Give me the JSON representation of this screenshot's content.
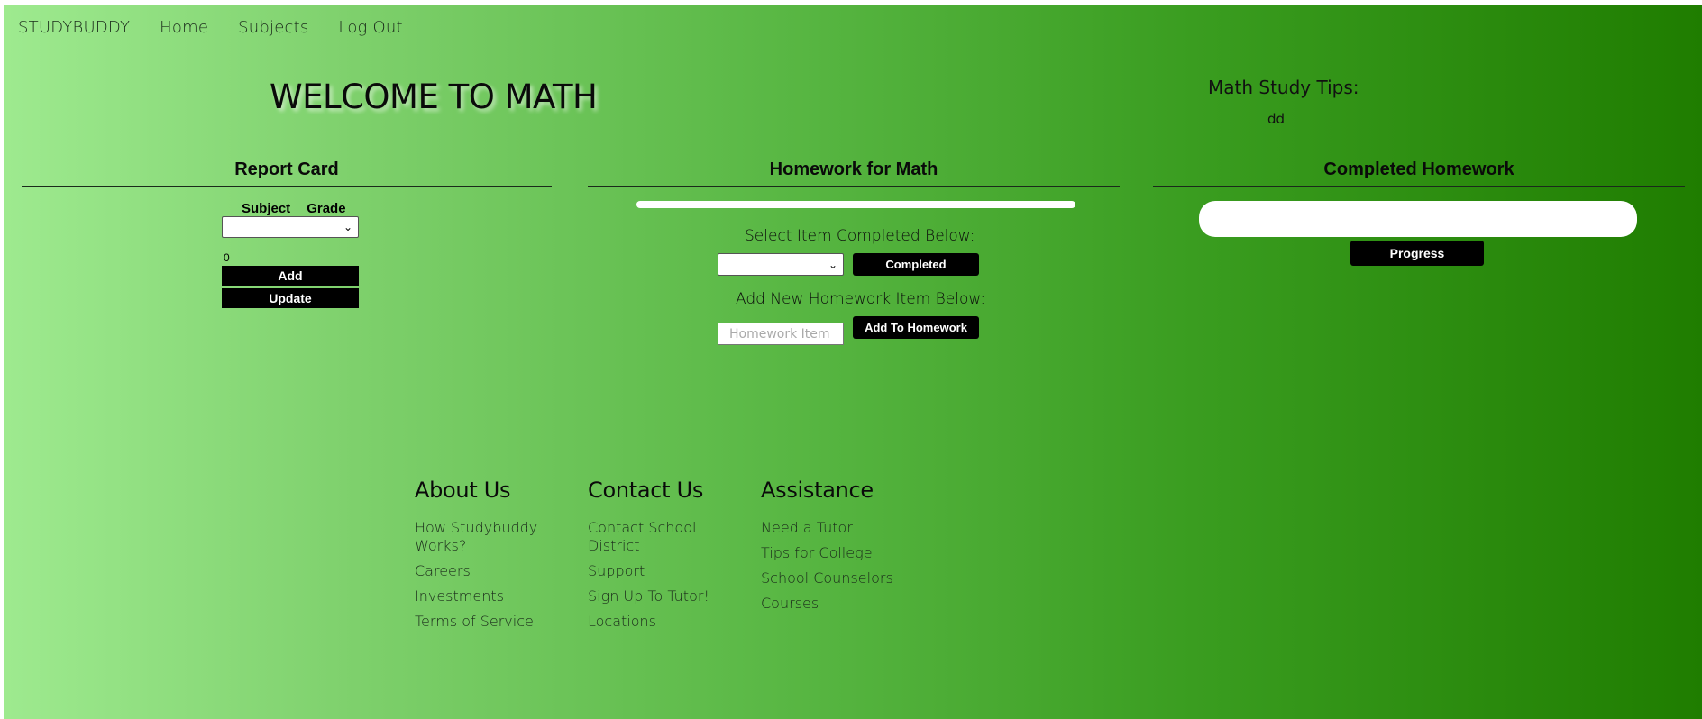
{
  "nav": {
    "brand": "STUDYBUDDY",
    "items": [
      "Home",
      "Subjects",
      "Log Out"
    ]
  },
  "welcome": "WELCOME TO MATH",
  "tips": {
    "title": "Math Study Tips:",
    "text": "dd"
  },
  "report_card": {
    "title": "Report Card",
    "headers": [
      "Subject",
      "Grade"
    ],
    "grade_value": "0",
    "add_label": "Add",
    "update_label": "Update"
  },
  "homework": {
    "title": "Homework for Math",
    "select_label": "Select Item Completed Below:",
    "completed_label": "Completed",
    "add_label": "Add New Homework Item Below:",
    "input_placeholder": "Homework Item",
    "add_button": "Add To Homework"
  },
  "completed": {
    "title": "Completed Homework",
    "progress_label": "Progress"
  },
  "footer": {
    "about": {
      "title": "About Us",
      "links": [
        "How Studybuddy Works?",
        "Careers",
        "Investments",
        "Terms of Service"
      ]
    },
    "contact": {
      "title": "Contact Us",
      "links": [
        "Contact School District",
        "Support",
        "Sign Up To Tutor!",
        "Locations"
      ]
    },
    "assistance": {
      "title": "Assistance",
      "links": [
        "Need a Tutor",
        "Tips for College",
        "School Counselors",
        "Courses"
      ]
    }
  }
}
